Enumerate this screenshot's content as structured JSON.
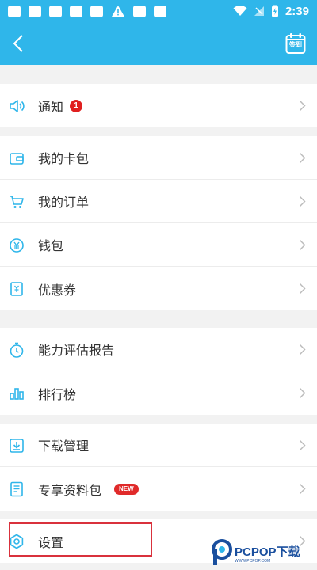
{
  "status_bar": {
    "time": "2:39"
  },
  "header": {
    "checkin_label": "签到"
  },
  "sections": [
    {
      "items": [
        {
          "label": "通知",
          "badge": "1"
        }
      ]
    },
    {
      "items": [
        {
          "label": "我的卡包"
        },
        {
          "label": "我的订单"
        },
        {
          "label": "钱包"
        },
        {
          "label": "优惠券"
        }
      ]
    },
    {
      "items": [
        {
          "label": "能力评估报告"
        },
        {
          "label": "排行榜"
        }
      ]
    },
    {
      "items": [
        {
          "label": "下载管理"
        },
        {
          "label": "专享资料包",
          "badge": "NEW"
        }
      ]
    },
    {
      "items": [
        {
          "label": "设置"
        }
      ]
    }
  ],
  "watermark": {
    "brand": "PCPOP下载",
    "sub": "WWW.PCPOP.COM"
  },
  "colors": {
    "header": "#2fb6ea",
    "icon": "#2fb6ea",
    "badge": "#e02020",
    "highlight": "#d9313c"
  }
}
